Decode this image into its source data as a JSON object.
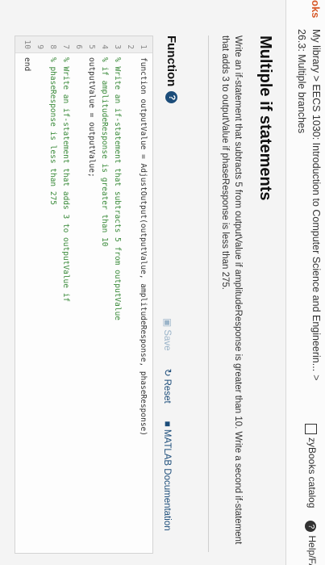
{
  "topbar": {
    "brand": "oks",
    "breadcrumb": "My library > EECS 1030: Introduction to Computer Science and Engineerin...",
    "breadcrumb_chevron": ">",
    "section": "26.3: Multiple branches",
    "catalog": "zyBooks catalog",
    "help": "Help/FAQ"
  },
  "main": {
    "title": "Multiple if statements",
    "description": "Write an if-statement that subtracts 5 from outputValue if amplitudeResponse is greater than 10. Write a second if-statement that adds 3 to outputValue if phaseResponse is less than 275."
  },
  "function_panel": {
    "heading": "Function",
    "help_icon": "?",
    "save_label": "Save",
    "reset_label": "Reset",
    "doc_label": "MATLAB Documentation"
  },
  "editor": {
    "lines": [
      {
        "n": "1",
        "text": "function outputValue = AdjustOutput(outputValue, amplitudeResponse, phaseResponse)",
        "kind": "code"
      },
      {
        "n": "2",
        "text": "",
        "kind": "code"
      },
      {
        "n": "3",
        "text": "% Write an if-statement that subtracts 5 from outputValue",
        "kind": "comment"
      },
      {
        "n": "4",
        "text": "% if amplitudeResponse is greater than 10",
        "kind": "comment"
      },
      {
        "n": "5",
        "text": "outputValue = outputValue;",
        "kind": "code"
      },
      {
        "n": "6",
        "text": "",
        "kind": "code"
      },
      {
        "n": "7",
        "text": "% Write an if-statement that adds 3 to outputValue if",
        "kind": "comment"
      },
      {
        "n": "8",
        "text": "% phaseResponse is less than 275",
        "kind": "comment"
      },
      {
        "n": "9",
        "text": "",
        "kind": "code"
      },
      {
        "n": "10",
        "text": "end",
        "kind": "code"
      }
    ]
  },
  "colors": {
    "brand": "#d85a2a",
    "link": "#1c4d7a",
    "comment": "#3a8a3a",
    "save_disabled": "#9bb4c9"
  }
}
